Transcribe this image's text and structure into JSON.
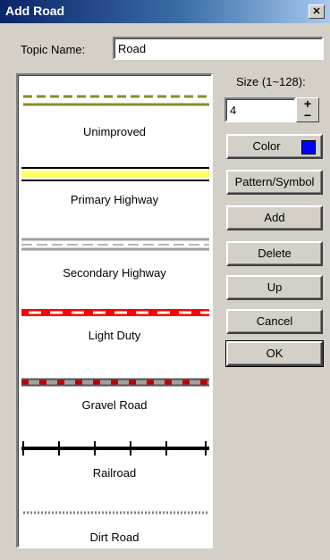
{
  "window": {
    "title": "Add Road",
    "close_glyph": "✕"
  },
  "topic": {
    "label": "Topic Name:",
    "value": "Road"
  },
  "size": {
    "label": "Size (1~128):",
    "value": "4",
    "up_glyph": "+",
    "down_glyph": "−"
  },
  "color": {
    "label": "Color",
    "swatch_color": "#0000ff"
  },
  "buttons": {
    "pattern": "Pattern/Symbol",
    "add": "Add",
    "delete": "Delete",
    "up": "Up",
    "cancel": "Cancel",
    "ok": "OK"
  },
  "road_types": [
    {
      "name": "Unimproved",
      "style": "olive-dashed-over-solid"
    },
    {
      "name": "Primary Highway",
      "style": "black-yellow-double"
    },
    {
      "name": "Secondary Highway",
      "style": "gray-double-dashed"
    },
    {
      "name": "Light Duty",
      "style": "red-white-dashed"
    },
    {
      "name": "Gravel Road",
      "style": "gray-red-dashed-dark-outline"
    },
    {
      "name": "Railroad",
      "style": "black-line-with-ties"
    },
    {
      "name": "Dirt Road",
      "style": "gray-dotted"
    }
  ]
}
